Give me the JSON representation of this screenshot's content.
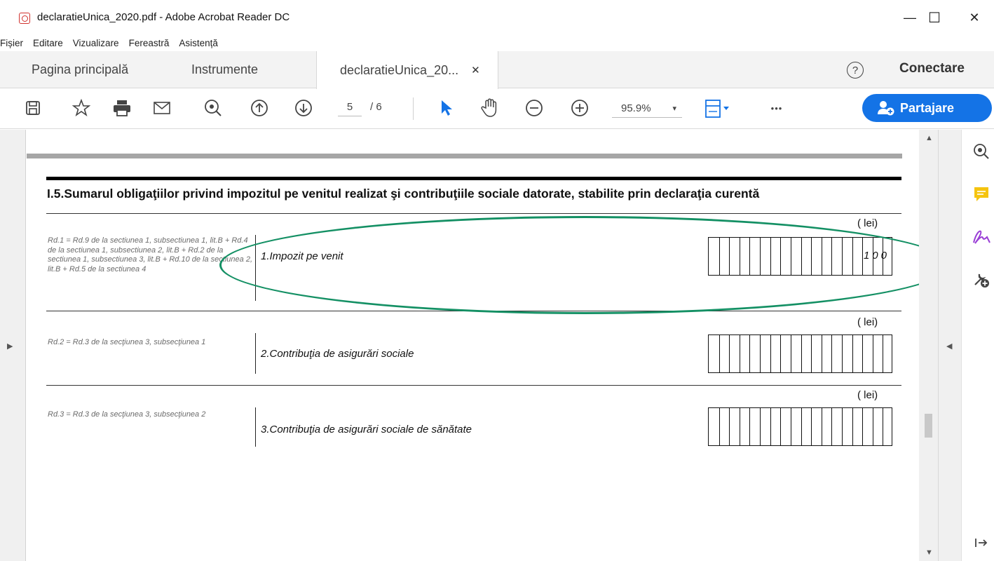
{
  "window": {
    "title": "declaratieUnica_2020.pdf - Adobe Acrobat Reader DC",
    "minimize": "—",
    "maximize": "☐",
    "close": "✕"
  },
  "menu": [
    "Fișier",
    "Editare",
    "Vizualizare",
    "Fereastră",
    "Asistență"
  ],
  "tabs": {
    "home": "Pagina principală",
    "tools": "Instrumente",
    "document": "declaratieUnica_20...",
    "document_close": "✕",
    "help": "?",
    "connect": "Conectare"
  },
  "toolbar": {
    "page_current": "5",
    "page_total": "/ 6",
    "zoom": "95.9%",
    "zoom_caret": "▾",
    "more": "•••",
    "share": "Partajare"
  },
  "icons": {
    "save": "save-icon",
    "bookmark": "star-icon",
    "print": "print-icon",
    "email": "mail-icon",
    "zoom_tool": "zoom-icon",
    "prev_page": "arrow-up-circle-icon",
    "next_page": "arrow-down-circle-icon",
    "select": "cursor-icon",
    "hand": "hand-icon",
    "zoom_out": "minus-circle-icon",
    "zoom_in": "plus-circle-icon",
    "fit": "fit-page-icon"
  },
  "colors": {
    "accent": "#1473e6",
    "ellipse": "#149064",
    "comment": "#f5c40f",
    "sign": "#9a3fd6"
  },
  "document": {
    "section_title": "I.5.Sumarul obligaţiilor privind impozitul pe venitul realizat şi contribuţiile sociale datorate, stabilite prin declaraţia curentă",
    "rows": [
      {
        "unit": "( lei)",
        "note": "Rd.1 = Rd.9 de la sectiunea 1, subsectiunea 1, lit.B + Rd.4 de la sectiunea 1, subsectiunea 2, lit.B + Rd.2 de la sectiunea 1, subsectiunea 3, lit.B + Rd.10 de la sectiunea 2, lit.B + Rd.5 de la sectiunea 4",
        "label": "1.Impozit pe venit",
        "value": "100"
      },
      {
        "unit": "( lei)",
        "note": "Rd.2 = Rd.3 de la secţiunea 3, subsecţiunea 1",
        "label": "2.Contribuţia de asigurări sociale",
        "value": ""
      },
      {
        "unit": "( lei)",
        "note": "Rd.3 = Rd.3 de la secţiunea 3, subsecţiunea 2",
        "label": "3.Contribuţia de asigurări sociale de sănătate",
        "value": ""
      }
    ]
  }
}
